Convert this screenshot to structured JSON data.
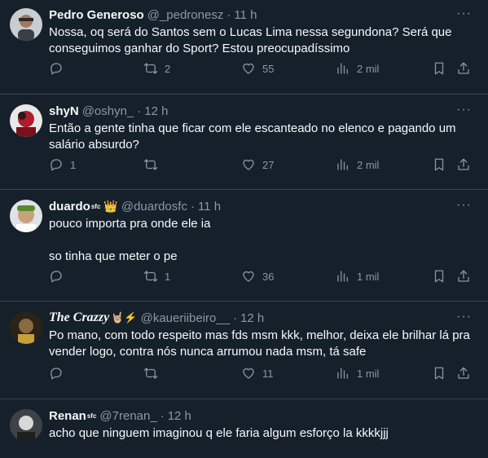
{
  "tweets": [
    {
      "name": "Pedro Generoso",
      "handle": "@_pedronesz",
      "time": "11 h",
      "text": "Nossa, oq será do Santos sem o Lucas Lima nessa segundona? Será que conseguimos ganhar do Sport? Estou preocupadíssimo",
      "replies": "",
      "retweets": "2",
      "likes": "55",
      "views": "2 mil"
    },
    {
      "name": "shyN",
      "handle": "@oshyn_",
      "time": "12 h",
      "text": "Então a gente tinha que ficar com ele escanteado no elenco e pagando um salário absurdo?",
      "replies": "1",
      "retweets": "",
      "likes": "27",
      "views": "2 mil"
    },
    {
      "name": "duardo",
      "name_badge": "sfc",
      "name_emoji": "👑",
      "handle": "@duardosfc",
      "time": "11 h",
      "text": "pouco importa pra onde ele ia\n\nso tinha que meter o pe",
      "replies": "",
      "retweets": "1",
      "likes": "36",
      "views": "1 mil"
    },
    {
      "name": "The Crazzy",
      "name_emoji": "🤘🏼⚡",
      "handle": "@kaueriibeiro__",
      "time": "12 h",
      "text": "Po mano, com todo respeito mas fds msm kkk, melhor, deixa ele brilhar lá pra vender logo, contra nós nunca arrumou nada msm, tá safe",
      "replies": "",
      "retweets": "",
      "likes": "11",
      "views": "1 mil"
    },
    {
      "name": "Renan",
      "name_badge": "sfc",
      "handle": "@7renan_",
      "time": "12 h",
      "text": "acho que ninguem imaginou q ele faria algum esforço la kkkkjjj"
    }
  ],
  "separator": "·",
  "more_label": "···",
  "colors": {
    "background": "#15202b",
    "text": "#f7f9f9",
    "muted": "#8b98a5",
    "border": "#38444d"
  },
  "icons": [
    "reply-icon",
    "retweet-icon",
    "like-icon",
    "views-icon",
    "bookmark-icon",
    "share-icon",
    "more-icon"
  ]
}
